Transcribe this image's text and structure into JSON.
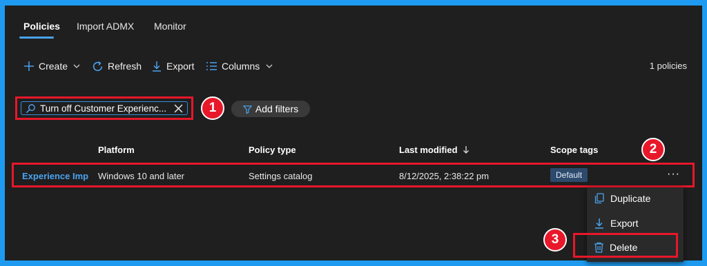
{
  "tabs": [
    {
      "label": "Policies",
      "active": true
    },
    {
      "label": "Import ADMX",
      "active": false
    },
    {
      "label": "Monitor",
      "active": false
    }
  ],
  "toolbar": {
    "create_label": "Create",
    "refresh_label": "Refresh",
    "export_label": "Export",
    "columns_label": "Columns",
    "count_text": "1 policies"
  },
  "search": {
    "value": "Turn off Customer Experienc..."
  },
  "filters": {
    "add_label": "Add filters"
  },
  "table": {
    "headers": {
      "platform": "Platform",
      "policy_type": "Policy type",
      "last_modified": "Last modified",
      "scope_tags": "Scope tags"
    },
    "rows": [
      {
        "name": "Experience Improvement",
        "platform": "Windows 10 and later",
        "policy_type": "Settings catalog",
        "last_modified": "8/12/2025, 2:38:22 pm",
        "scope_tag": "Default"
      }
    ]
  },
  "context_menu": {
    "items": [
      "Duplicate",
      "Export",
      "Delete"
    ]
  },
  "annotations": [
    "1",
    "2",
    "3"
  ],
  "colors": {
    "accent": "#4aa3f0",
    "highlight": "#e8172a",
    "background": "#1f1f1f",
    "border": "#1e9bf0"
  },
  "icons": [
    "plus-icon",
    "chevron-down-icon",
    "refresh-icon",
    "download-icon",
    "columns-icon",
    "search-icon",
    "clear-icon",
    "filter-icon",
    "sort-arrow-icon",
    "more-icon",
    "duplicate-icon",
    "trash-icon"
  ]
}
